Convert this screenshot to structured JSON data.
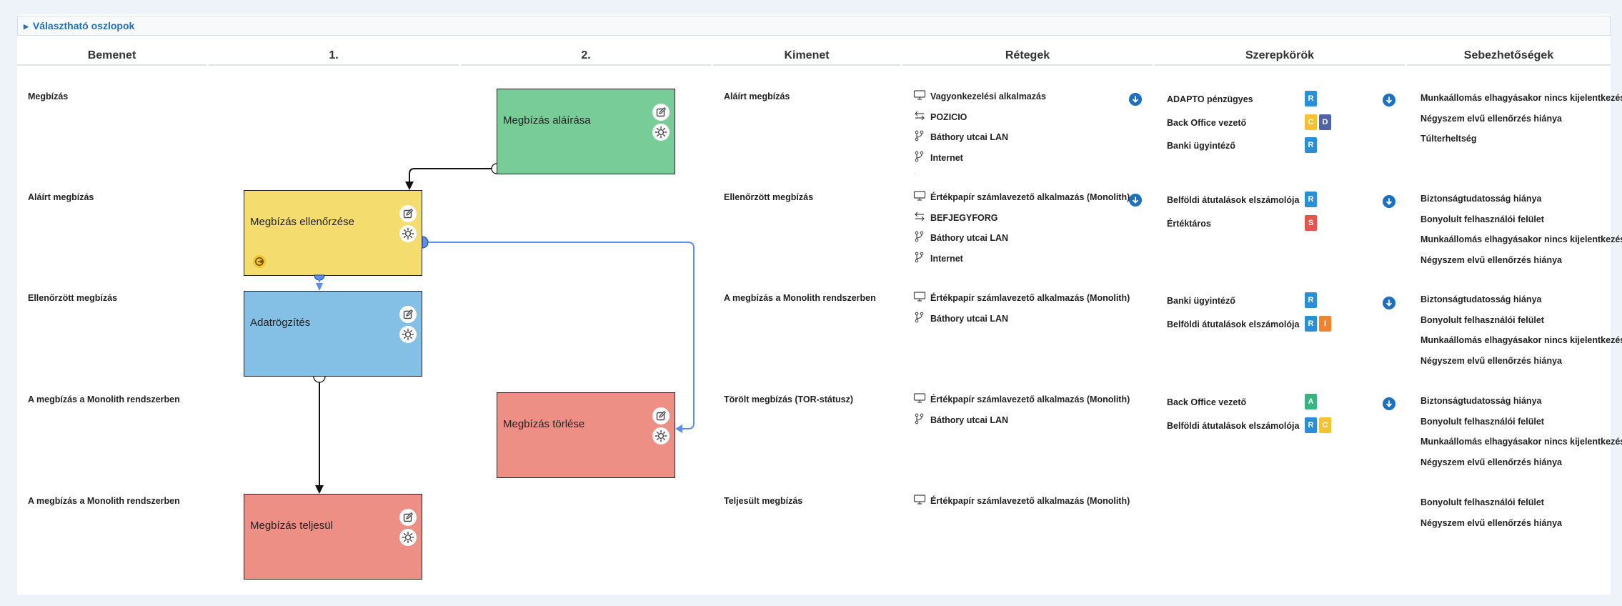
{
  "column_toggle": {
    "label": "Választható oszlopok"
  },
  "headers": {
    "input": "Bemenet",
    "lane1": "1.",
    "lane2": "2.",
    "output": "Kimenet",
    "layers": "Rétegek",
    "roles": "Szerepkörök",
    "vulns": "Sebezhetőségek"
  },
  "colors": {
    "green_box": "#78cc98",
    "yellow_box": "#f4dc6e",
    "blue_box": "#84bfe5",
    "red_box": "#ee8f85",
    "badge_blue": "#2b8fd6",
    "badge_yellow": "#f4c233",
    "badge_navy": "#5163a6",
    "badge_red": "#e5544d",
    "badge_orange": "#ed8430",
    "badge_green": "#3bb380",
    "link_blue": "#1d6fc0",
    "edge_blue": "#5b8ef0"
  },
  "inputs": [
    "Megbízás",
    "Aláírt megbízás",
    "Ellenőrzött megbízás",
    "A megbízás a Monolith rendszerben",
    "A megbízás a Monolith rendszerben"
  ],
  "steps": [
    {
      "label": "Megbízás aláírása",
      "lane": 2,
      "color": "green"
    },
    {
      "label": "Megbízás ellenőrzése",
      "lane": 1,
      "color": "yellow"
    },
    {
      "label": "Adatrögzítés",
      "lane": 1,
      "color": "blue"
    },
    {
      "label": "Megbízás törlése",
      "lane": 2,
      "color": "red"
    },
    {
      "label": "Megbízás teljesül",
      "lane": 1,
      "color": "red"
    }
  ],
  "outputs": [
    "Aláírt megbízás",
    "Ellenőrzött megbízás",
    "A megbízás a Monolith rendszerben",
    "Törölt megbízás (TOR-státusz)",
    "Teljesült megbízás"
  ],
  "layers": [
    [
      {
        "icon": "monitor-icon",
        "text": "Vagyonkezelési alkalmazás"
      },
      {
        "icon": "arrows-exchange-icon",
        "text": "POZICIO"
      },
      {
        "icon": "network-branch-icon",
        "text": "Báthory utcai LAN"
      },
      {
        "icon": "network-branch-icon",
        "text": "Internet"
      }
    ],
    [
      {
        "icon": "monitor-icon",
        "text": "Értékpapír számlavezető alkalmazás (Monolith)"
      },
      {
        "icon": "arrows-exchange-icon",
        "text": "BEFJEGYFORG"
      },
      {
        "icon": "network-branch-icon",
        "text": "Báthory utcai LAN"
      },
      {
        "icon": "network-branch-icon",
        "text": "Internet"
      }
    ],
    [
      {
        "icon": "monitor-icon",
        "text": "Értékpapír számlavezető alkalmazás (Monolith)"
      },
      {
        "icon": "network-branch-icon",
        "text": "Báthory utcai LAN"
      }
    ],
    [
      {
        "icon": "monitor-icon",
        "text": "Értékpapír számlavezető alkalmazás (Monolith)"
      },
      {
        "icon": "network-branch-icon",
        "text": "Báthory utcai LAN"
      }
    ],
    [
      {
        "icon": "monitor-icon",
        "text": "Értékpapír számlavezető alkalmazás (Monolith)"
      }
    ]
  ],
  "roles": [
    [
      {
        "name": "ADAPTO pénzügyes",
        "badges": [
          "R"
        ]
      },
      {
        "name": "Back Office vezető",
        "badges": [
          "C",
          "D"
        ]
      },
      {
        "name": "Banki ügyintéző",
        "badges": [
          "R"
        ]
      }
    ],
    [
      {
        "name": "Belföldi átutalások elszámolója",
        "badges": [
          "R"
        ]
      },
      {
        "name": "Értéktáros",
        "badges": [
          "S"
        ]
      }
    ],
    [
      {
        "name": "Banki ügyintéző",
        "badges": [
          "R"
        ]
      },
      {
        "name": "Belföldi átutalások elszámolója",
        "badges": [
          "R",
          "I"
        ]
      }
    ],
    [
      {
        "name": "Back Office vezető",
        "badges": [
          "A"
        ]
      },
      {
        "name": "Belföldi átutalások elszámolója",
        "badges": [
          "R",
          "C"
        ]
      }
    ],
    []
  ],
  "vulnerabilities": [
    [
      "Munkaállomás elhagyásakor nincs kijelentkezés",
      "Négyszem elvű ellenőrzés hiánya",
      "Túlterheltség"
    ],
    [
      "Biztonságtudatosság hiánya",
      "Bonyolult felhasználói felület",
      "Munkaállomás elhagyásakor nincs kijelentkezés",
      "Négyszem elvű ellenőrzés hiánya"
    ],
    [
      "Biztonságtudatosság hiánya",
      "Bonyolult felhasználói felület",
      "Munkaállomás elhagyásakor nincs kijelentkezés",
      "Négyszem elvű ellenőrzés hiánya"
    ],
    [
      "Biztonságtudatosság hiánya",
      "Bonyolult felhasználói felület",
      "Munkaállomás elhagyásakor nincs kijelentkezés",
      "Négyszem elvű ellenőrzés hiánya"
    ],
    [
      "Bonyolult felhasználói felület",
      "Négyszem elvű ellenőrzés hiánya"
    ]
  ]
}
